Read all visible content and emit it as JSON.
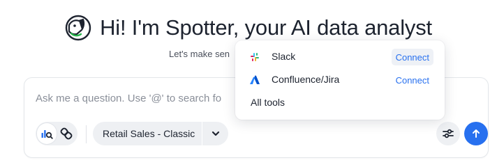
{
  "header": {
    "logo_icon": "spotter-dog-icon",
    "title": "Hi! I'm Spotter, your AI data analyst",
    "subtitle": "Let's make sen"
  },
  "chat": {
    "placeholder": "Ask me a question. Use '@' to search fo",
    "modes": [
      {
        "icon": "chart-search-icon",
        "active": true
      },
      {
        "icon": "link-icon",
        "active": false
      }
    ],
    "data_source": {
      "label": "Retail Sales - Classic",
      "chevron_icon": "chevron-down-icon"
    },
    "settings_icon": "sliders-icon",
    "send_icon": "arrow-up-icon"
  },
  "connectors": {
    "items": [
      {
        "name": "Slack",
        "icon": "slack-icon",
        "action": "Connect"
      },
      {
        "name": "Confluence/Jira",
        "icon": "atlassian-icon",
        "action": "Connect"
      }
    ],
    "all_tools": "All tools"
  },
  "colors": {
    "accent": "#2770ef",
    "chip_bg": "#eef0f3",
    "text": "#1d232f",
    "muted": "#8a8f99"
  }
}
